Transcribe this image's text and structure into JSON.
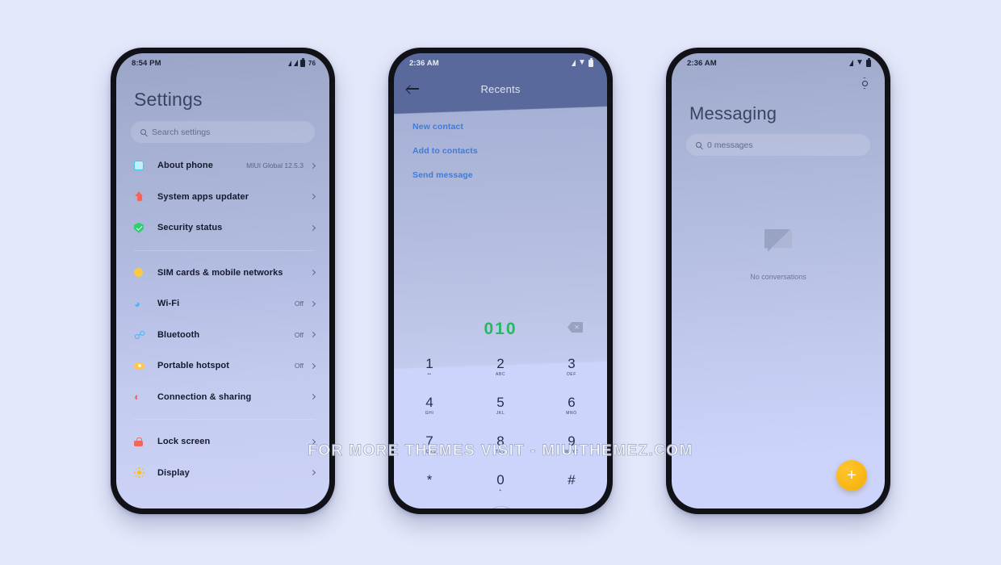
{
  "canvas": {
    "background_color": "#e4e8fb",
    "watermark": "FOR MORE THEMES VISIT - MIUITHEMEZ.COM"
  },
  "phones": {
    "settings": {
      "status_bar": {
        "time": "8:54 PM",
        "battery_percent": "76",
        "signal_icon": "signal-triangle-icon",
        "battery_icon": "battery-icon"
      },
      "title": "Settings",
      "search": {
        "placeholder": "Search settings",
        "icon": "search-icon"
      },
      "groups": [
        {
          "items": [
            {
              "label": "About phone",
              "value": "MIUI Global 12.5.3",
              "icon": "about-phone-icon",
              "chevron": "chevron-right-icon"
            },
            {
              "label": "System apps updater",
              "value": "",
              "icon": "system-updater-icon",
              "chevron": "chevron-right-icon"
            },
            {
              "label": "Security status",
              "value": "",
              "icon": "security-shield-icon",
              "chevron": "chevron-right-icon"
            }
          ]
        },
        {
          "items": [
            {
              "label": "SIM cards & mobile networks",
              "value": "",
              "icon": "sim-card-icon",
              "chevron": "chevron-right-icon"
            },
            {
              "label": "Wi-Fi",
              "value": "Off",
              "icon": "wifi-icon",
              "chevron": "chevron-right-icon"
            },
            {
              "label": "Bluetooth",
              "value": "Off",
              "icon": "bluetooth-icon",
              "chevron": "chevron-right-icon"
            },
            {
              "label": "Portable hotspot",
              "value": "Off",
              "icon": "hotspot-icon",
              "chevron": "chevron-right-icon"
            },
            {
              "label": "Connection & sharing",
              "value": "",
              "icon": "connection-sharing-icon",
              "chevron": "chevron-right-icon"
            }
          ]
        },
        {
          "items": [
            {
              "label": "Lock screen",
              "value": "",
              "icon": "lock-icon",
              "chevron": "chevron-right-icon"
            },
            {
              "label": "Display",
              "value": "",
              "icon": "display-brightness-icon",
              "chevron": "chevron-right-icon"
            }
          ]
        }
      ]
    },
    "dialer": {
      "status_bar": {
        "time": "2:36 AM",
        "signal_icon": "signal-triangle-icon",
        "wifi_icon": "wifi-icon",
        "battery_icon": "battery-icon"
      },
      "appbar": {
        "title": "Recents",
        "back_icon": "back-arrow-icon"
      },
      "actions": [
        "New contact",
        "Add to contacts",
        "Send message"
      ],
      "number_display": {
        "value": "010",
        "color": "#28b765",
        "backspace_icon": "backspace-icon"
      },
      "keys": [
        {
          "digit": "1",
          "letters": "••"
        },
        {
          "digit": "2",
          "letters": "ABC"
        },
        {
          "digit": "3",
          "letters": "DEF"
        },
        {
          "digit": "4",
          "letters": "GHI"
        },
        {
          "digit": "5",
          "letters": "JKL"
        },
        {
          "digit": "6",
          "letters": "MNO"
        },
        {
          "digit": "7",
          "letters": "PQRS"
        },
        {
          "digit": "8",
          "letters": "TUV"
        },
        {
          "digit": "9",
          "letters": "WXYZ"
        },
        {
          "digit": "*",
          "letters": ""
        },
        {
          "digit": "0",
          "letters": "+"
        },
        {
          "digit": "#",
          "letters": ""
        }
      ],
      "bottom_bar": {
        "menu_icon": "menu-icon",
        "call_icon": "call-handset-icon",
        "keypad_icon": "keypad-grid-icon"
      }
    },
    "messaging": {
      "status_bar": {
        "time": "2:36 AM",
        "signal_icon": "signal-triangle-icon",
        "wifi_icon": "wifi-icon",
        "battery_icon": "battery-icon"
      },
      "settings_icon": "gear-icon",
      "title": "Messaging",
      "search": {
        "placeholder": "0 messages",
        "icon": "search-icon"
      },
      "empty_state": {
        "icon": "chat-bubble-icon",
        "text": "No conversations"
      },
      "fab": {
        "label": "+",
        "icon": "add-icon",
        "color": "#f5b20a"
      }
    }
  }
}
